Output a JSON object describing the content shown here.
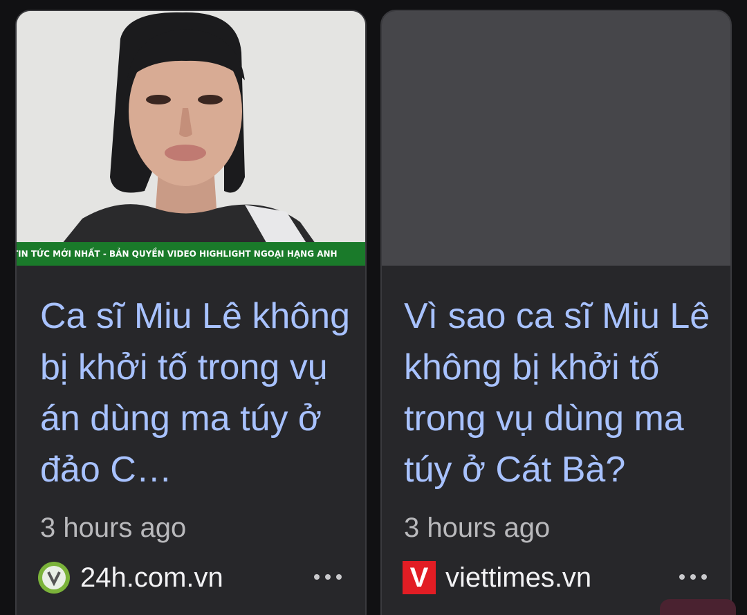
{
  "cards": [
    {
      "ticker": "TIN TỨC MỚI NHẤT - BẢN QUYỀN VIDEO HIGHLIGHT NGOẠI HẠNG ANH",
      "headline": "Ca sĩ Miu Lê không bị khởi tố trong vụ án dùng ma túy ở đảo C…",
      "time": "3 hours ago",
      "source": "24h.com.vn",
      "source_logo": "24h-logo-icon",
      "more_icon": "more-horizontal-icon"
    },
    {
      "headline": "Vì sao ca sĩ Miu Lê không bị khởi tố trong vụ dùng ma túy ở Cát Bà?",
      "time": "3 hours ago",
      "source": "viettimes.vn",
      "source_logo_letter": "V",
      "source_logo": "viettimes-logo-icon",
      "more_icon": "more-horizontal-icon"
    }
  ],
  "colors": {
    "headline": "#a8c2ff",
    "card_bg": "#27272a",
    "page_bg": "#111113",
    "ticker_bg": "#1a7a2a",
    "viettimes_red": "#e21d24"
  }
}
